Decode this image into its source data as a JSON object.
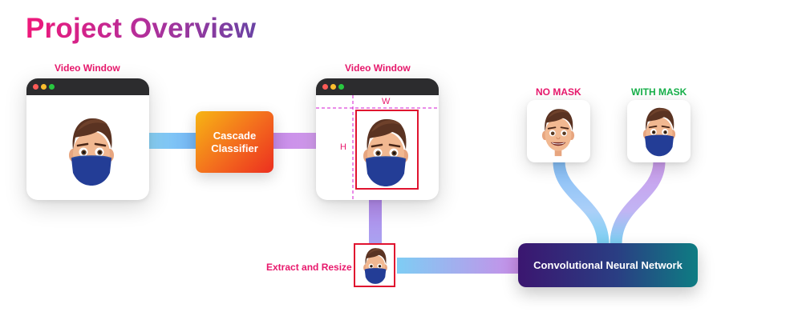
{
  "title": "Project Overview",
  "left_window": {
    "label": "Video Window"
  },
  "cascade": {
    "label": "Cascade Classifier"
  },
  "right_window": {
    "label": "Video Window",
    "width_label": "W",
    "height_label": "H"
  },
  "extract": {
    "label": "Extract and Resize"
  },
  "cnn": {
    "label": "Convolutional Neural Network"
  },
  "outputs": {
    "no_mask": "NO MASK",
    "with_mask": "WITH MASK"
  },
  "colors": {
    "title_start": "#f0187a",
    "title_end": "#6a43a4",
    "label_pink": "#e8186c",
    "label_green": "#17b04a",
    "bbox": "#e0132f",
    "guide": "#d41ad0"
  },
  "icons": {
    "avatar": "memoji-avatar-icon",
    "window_controls": "window-controls-icon"
  }
}
